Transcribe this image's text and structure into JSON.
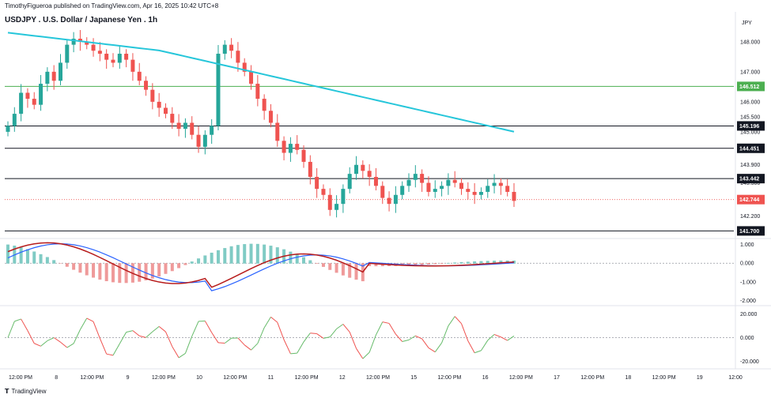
{
  "header": {
    "publisher": "TimothyFigueroa published on TradingView.com, Apr 16, 2025 10:42 UTC+8",
    "title": "USDJPY . U.S. Dollar / Japanese Yen . 1h",
    "currency": "JPY",
    "brand": "TradingView"
  },
  "colors": {
    "up": "#26a69a",
    "down": "#ef5350",
    "ma": "#26c6da",
    "hline": "#131722",
    "green_line": "#4caf50",
    "current": "#ef5350"
  },
  "chart_data": [
    {
      "type": "candlestick",
      "title": "USDJPY . U.S. Dollar / Japanese Yen . 1h",
      "ylim": [
        141.5,
        148.6
      ],
      "y_ticks": [
        "148.000",
        "147.000",
        "146.000",
        "145.500",
        "145.000",
        "143.900",
        "143.300",
        "142.200"
      ],
      "x_ticks": [
        "12:00 PM",
        "8",
        "12:00 PM",
        "9",
        "12:00 PM",
        "10",
        "12:00 PM",
        "11",
        "12:00 PM",
        "12",
        "12:00 PM",
        "15",
        "12:00 PM",
        "16",
        "12:00 PM",
        "17",
        "12:00 PM",
        "18",
        "12:00 PM",
        "19",
        "12:00"
      ],
      "price_levels": [
        {
          "label": "146.512",
          "value": 146.512,
          "kind": "green"
        },
        {
          "label": "145.196",
          "value": 145.196,
          "kind": "black"
        },
        {
          "label": "144.451",
          "value": 144.451,
          "kind": "black"
        },
        {
          "label": "143.442",
          "value": 143.442,
          "kind": "black"
        },
        {
          "label": "142.744",
          "value": 142.744,
          "kind": "current"
        },
        {
          "label": "141.700",
          "value": 141.7,
          "kind": "black"
        }
      ],
      "closes": [
        145.2,
        145.6,
        146.3,
        146.1,
        145.9,
        146.6,
        147.0,
        146.7,
        147.3,
        147.9,
        148.1,
        148.0,
        147.9,
        147.7,
        147.6,
        147.4,
        147.3,
        147.6,
        147.4,
        147.0,
        146.7,
        146.4,
        146.0,
        145.8,
        145.6,
        145.3,
        145.1,
        145.3,
        144.9,
        144.5,
        144.9,
        145.2,
        147.6,
        147.9,
        147.7,
        147.3,
        147.0,
        146.6,
        146.1,
        145.7,
        145.3,
        144.7,
        144.3,
        144.6,
        144.4,
        144.0,
        143.5,
        143.1,
        142.9,
        142.4,
        142.6,
        143.1,
        143.6,
        143.9,
        143.7,
        143.5,
        143.2,
        142.8,
        142.6,
        142.9,
        143.2,
        143.4,
        143.6,
        143.3,
        143.0,
        143.1,
        143.2,
        143.4,
        143.3,
        143.1,
        143.0,
        142.9,
        143.0,
        143.2,
        143.3,
        143.2,
        143.0,
        142.7
      ],
      "ma_start": 148.3,
      "ma_end": 145.0
    },
    {
      "type": "line",
      "name": "momentum oscillator",
      "ylim": [
        -2.2,
        1.2
      ],
      "y_ticks": [
        "1.000",
        "0.000",
        "-1.000",
        "-2.000"
      ]
    },
    {
      "type": "line",
      "name": "rsi-style oscillator",
      "ylim": [
        -25,
        25
      ],
      "y_ticks": [
        "20.000",
        "0.000",
        "-20.000"
      ]
    }
  ]
}
